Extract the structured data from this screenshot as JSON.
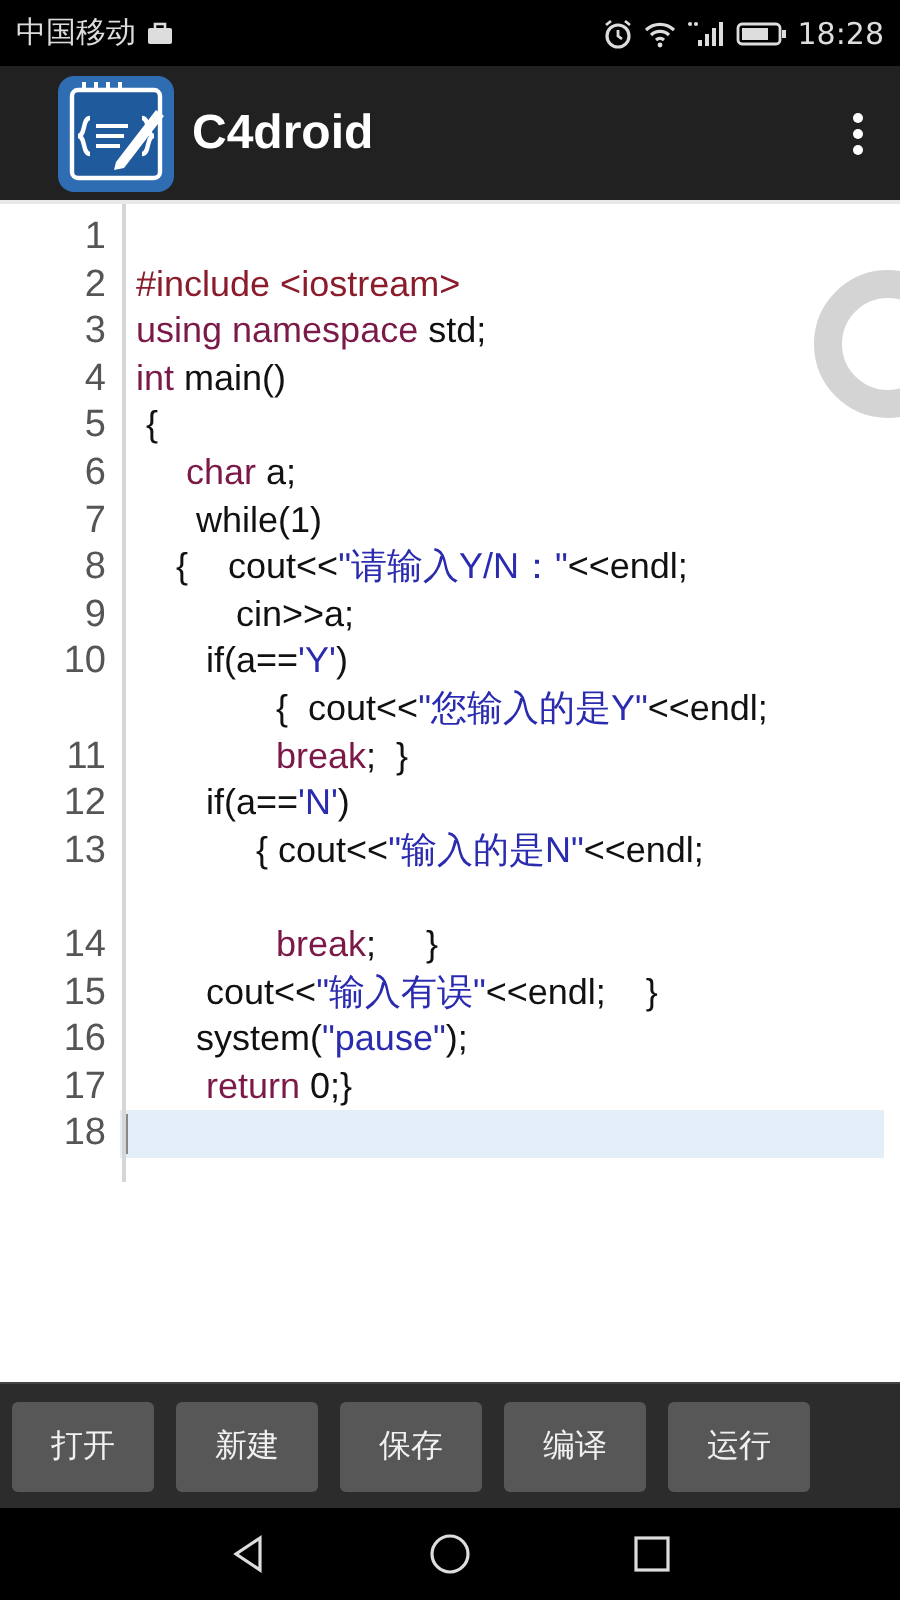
{
  "status_bar": {
    "carrier": "中国移动",
    "time": "18:28"
  },
  "app_bar": {
    "title": "C4droid"
  },
  "editor": {
    "lines": [
      {
        "number": "1",
        "current": false
      },
      {
        "number": "2",
        "current": false,
        "tokens": [
          {
            "text": "#include <iostream>",
            "kind": "pre"
          }
        ]
      },
      {
        "number": "3",
        "current": false,
        "tokens": [
          {
            "text": "using namespace",
            "kind": "kw"
          },
          {
            "text": " std;",
            "kind": "plain"
          }
        ]
      },
      {
        "number": "4",
        "current": false,
        "tokens": [
          {
            "text": "int",
            "kind": "kw"
          },
          {
            "text": " main()",
            "kind": "plain"
          }
        ]
      },
      {
        "number": "5",
        "current": false,
        "tokens": [
          {
            "text": " {",
            "kind": "plain"
          }
        ]
      },
      {
        "number": "6",
        "current": false,
        "tokens": [
          {
            "text": "     char",
            "kind": "kw"
          },
          {
            "text": " a;",
            "kind": "plain"
          }
        ]
      },
      {
        "number": "7",
        "current": false,
        "tokens": [
          {
            "text": "      while(1)",
            "kind": "plain"
          }
        ]
      },
      {
        "number": "8",
        "current": false,
        "tokens": [
          {
            "text": "    {    cout<<",
            "kind": "plain"
          },
          {
            "text": "\"请输入Y/N：\"",
            "kind": "str"
          },
          {
            "text": "<<endl;",
            "kind": "plain"
          }
        ]
      },
      {
        "number": "9",
        "current": false,
        "tokens": [
          {
            "text": "          cin>>a;",
            "kind": "plain"
          }
        ]
      },
      {
        "number": "10",
        "current": false,
        "tokens": [
          {
            "text": "       if(a==",
            "kind": "plain"
          },
          {
            "text": "'Y'",
            "kind": "str"
          },
          {
            "text": ")",
            "kind": "plain"
          }
        ],
        "continuation": [
          {
            "text": "              {  cout<<",
            "kind": "plain"
          },
          {
            "text": "\"您输入的是Y\"",
            "kind": "str"
          },
          {
            "text": "<<endl;",
            "kind": "plain"
          }
        ]
      },
      {
        "number": "11",
        "current": false,
        "tokens": [
          {
            "text": "              break",
            "kind": "kw"
          },
          {
            "text": ";  }",
            "kind": "plain"
          }
        ]
      },
      {
        "number": "12",
        "current": false,
        "tokens": [
          {
            "text": "       if(a==",
            "kind": "plain"
          },
          {
            "text": "'N'",
            "kind": "str"
          },
          {
            "text": ")",
            "kind": "plain"
          }
        ]
      },
      {
        "number": "13",
        "current": false,
        "tokens": [
          {
            "text": "            { cout<<",
            "kind": "plain"
          },
          {
            "text": "\"输入的是N\"",
            "kind": "str"
          },
          {
            "text": "<<endl;",
            "kind": "plain"
          }
        ]
      },
      {
        "number": "14",
        "current": false,
        "tokens": [
          {
            "text": "              break",
            "kind": "kw"
          },
          {
            "text": ";     }",
            "kind": "plain"
          }
        ]
      },
      {
        "number": "15",
        "current": false,
        "tokens": [
          {
            "text": "       cout<<",
            "kind": "plain"
          },
          {
            "text": "\"输入有误\"",
            "kind": "str"
          },
          {
            "text": "<<endl;    }",
            "kind": "plain"
          }
        ]
      },
      {
        "number": "16",
        "current": false,
        "tokens": [
          {
            "text": "      system(",
            "kind": "plain"
          },
          {
            "text": "\"pause\"",
            "kind": "str"
          },
          {
            "text": ");",
            "kind": "plain"
          }
        ]
      },
      {
        "number": "17",
        "current": false,
        "tokens": [
          {
            "text": "       return",
            "kind": "kw"
          },
          {
            "text": " 0;}",
            "kind": "plain"
          }
        ]
      },
      {
        "number": "18",
        "current": true
      }
    ]
  },
  "toolbar": {
    "buttons": [
      "打开",
      "新建",
      "保存",
      "编译",
      "运行"
    ]
  }
}
